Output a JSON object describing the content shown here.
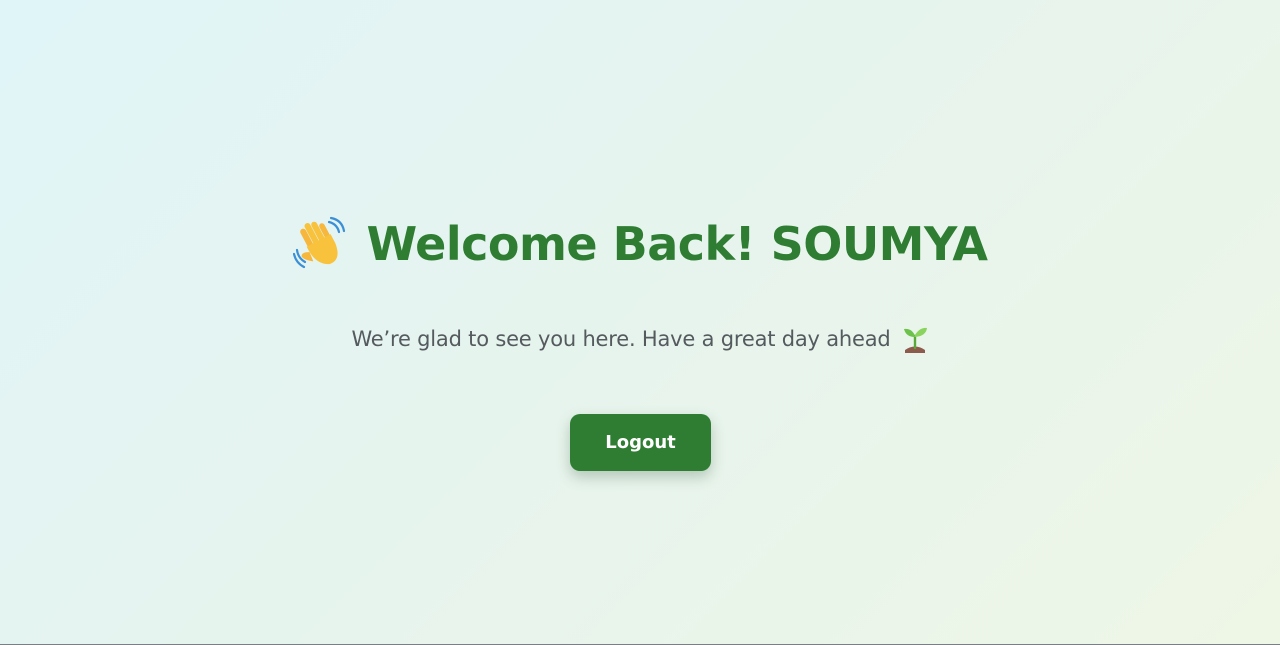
{
  "welcome": {
    "title": "Welcome Back! SOUMYA",
    "title_icon": "waving-hand-icon",
    "subtitle": "We’re glad to see you here. Have a great day ahead",
    "subtitle_icon": "seedling-icon"
  },
  "actions": {
    "logout_label": "Logout"
  },
  "colors": {
    "accent": "#2e7d32",
    "subtitle_text": "#555a5e",
    "background_start": "#e0f5f8",
    "background_end": "#eef6e6"
  }
}
